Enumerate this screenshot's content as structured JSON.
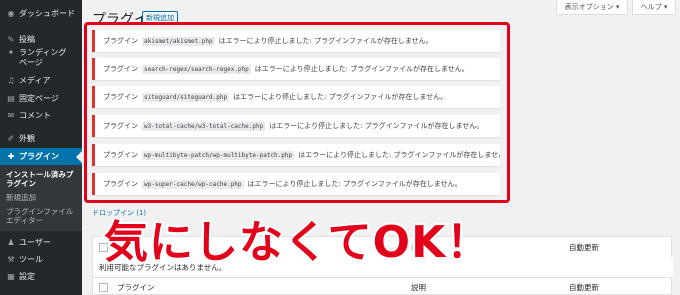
{
  "sidebar": {
    "items": [
      {
        "icon": "dashboard-icon",
        "glyph": "◉",
        "label": "ダッシュボード"
      },
      {
        "icon": "pin-icon",
        "glyph": "✎",
        "label": "投稿"
      },
      {
        "icon": "landing-icon",
        "glyph": "✦",
        "label": "ランディングページ"
      },
      {
        "icon": "media-icon",
        "glyph": "♫",
        "label": "メディア"
      },
      {
        "icon": "page-icon",
        "glyph": "▤",
        "label": "固定ページ"
      },
      {
        "icon": "comment-icon",
        "glyph": "✉",
        "label": "コメント"
      },
      {
        "icon": "appearance-icon",
        "glyph": "✐",
        "label": "外観"
      },
      {
        "icon": "plugin-icon",
        "glyph": "✚",
        "label": "プラグイン"
      },
      {
        "icon": "users-icon",
        "glyph": "♟",
        "label": "ユーザー"
      },
      {
        "icon": "tools-icon",
        "glyph": "⚒",
        "label": "ツール"
      },
      {
        "icon": "settings-icon",
        "glyph": "▦",
        "label": "設定"
      }
    ],
    "submenu": [
      "インストール済みプラグイン",
      "新規追加",
      "プラグインファイルエディター"
    ]
  },
  "header": {
    "title": "プラグイン",
    "add_new": "新規追加",
    "screen_options": "表示オプション ▾",
    "help": "ヘルプ ▾"
  },
  "notices": [
    {
      "prefix": "プラグイン",
      "file": "akismet/akismet.php",
      "suffix": "はエラーにより停止しました: プラグインファイルが存在しません。"
    },
    {
      "prefix": "プラグイン",
      "file": "search-regex/search-regex.php",
      "suffix": "はエラーにより停止しました: プラグインファイルが存在しません。"
    },
    {
      "prefix": "プラグイン",
      "file": "siteguard/siteguard.php",
      "suffix": "はエラーにより停止しました: プラグインファイルが存在しません。"
    },
    {
      "prefix": "プラグイン",
      "file": "w3-total-cache/w3-total-cache.php",
      "suffix": "はエラーにより停止しました: プラグインファイルが存在しません。"
    },
    {
      "prefix": "プラグイン",
      "file": "wp-multibyte-patch/wp-multibyte-patch.php",
      "suffix": "はエラーにより停止しました: プラグインファイルが存在しません。"
    },
    {
      "prefix": "プラグイン",
      "file": "wp-super-cache/wp-cache.php",
      "suffix": "はエラーにより停止しました: プラグインファイルが存在しません。"
    }
  ],
  "dropin_link": "ドロップイン (1)",
  "table": {
    "col_plugin": "プラグイン",
    "col_description": "説明",
    "col_autoupdate": "自動更新",
    "empty_message": "利用可能なプラグインはありません。",
    "header_partial": "プ",
    "header_mark": "ⅰ"
  },
  "overlay_text": "気にしなくてOK！",
  "colors": {
    "accent": "#0073aa",
    "error": "#dc3232",
    "highlight": "#e2001a",
    "sidebar": "#23282d"
  }
}
